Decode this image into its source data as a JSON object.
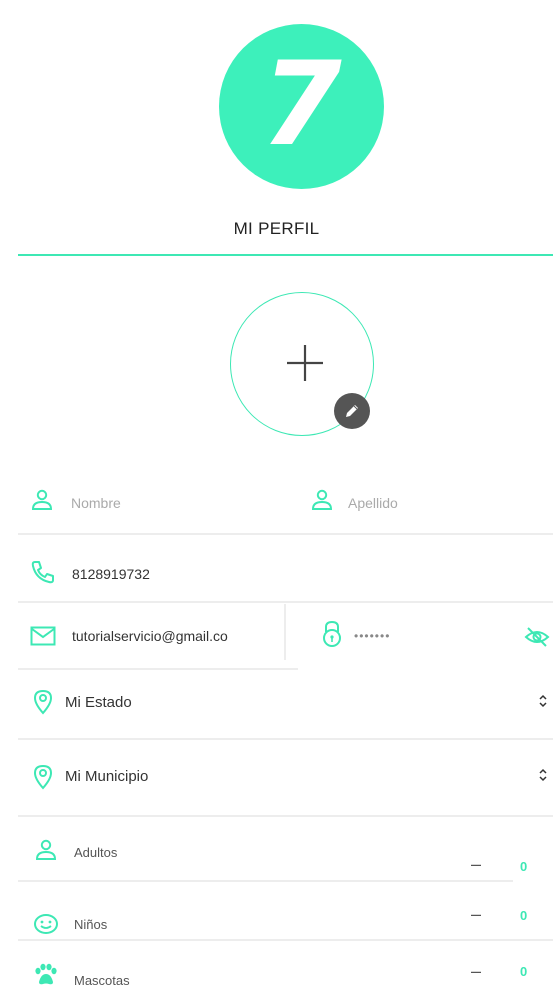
{
  "logo": {
    "number": "7"
  },
  "header": {
    "title": "MI PERFIL"
  },
  "form": {
    "nombre_placeholder": "Nombre",
    "apellido_placeholder": "Apellido",
    "phone_value": "8128919732",
    "email_value": "tutorialservicio@gmail.c⁠o",
    "password_mask": "•••••••",
    "estado_label": "Mi Estado",
    "municipio_label": "Mi Municipio",
    "adultos_label": "Adultos",
    "ninos_label": "Niños",
    "mascotas_label": "Mascotas",
    "adultos_value": "0",
    "ninos_value": "0",
    "mascotas_value": "0",
    "minus": "–"
  },
  "colors": {
    "accent": "#3de8b4",
    "logo": "#3df0bb",
    "badge": "#555555"
  },
  "icons": [
    "plus-icon",
    "pencil-icon",
    "user-icon",
    "phone-icon",
    "mail-icon",
    "lock-icon",
    "eye-off-icon",
    "location-pin-icon",
    "chevron-updown-icon",
    "smile-icon",
    "paw-icon"
  ]
}
